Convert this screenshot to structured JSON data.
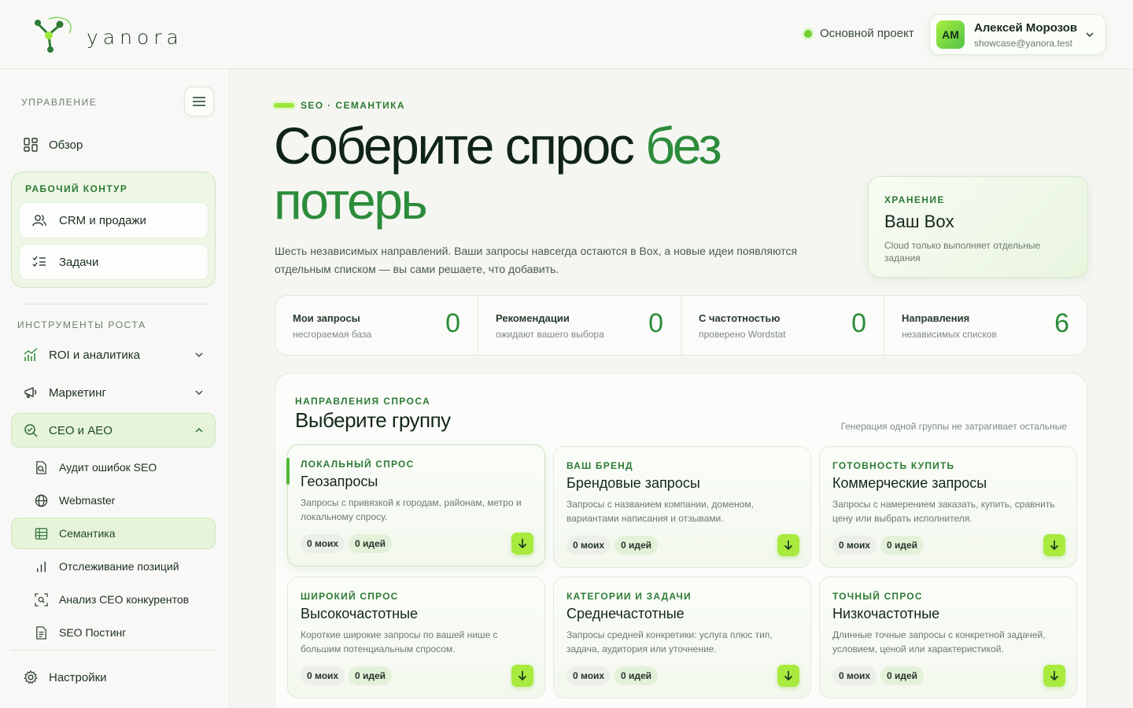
{
  "header": {
    "logo_text": "yanora",
    "project_label": "Основной проект",
    "user": {
      "initials": "AM",
      "name": "Алексей Морозов",
      "email": "showcase@yanora.test"
    }
  },
  "sidebar": {
    "section_manage": "УПРАВЛЕНИЕ",
    "overview": "Обзор",
    "work_title": "РАБОЧИЙ КОНТУР",
    "work_items": [
      "CRM и продажи",
      "Задачи"
    ],
    "section_growth": "ИНСТРУМЕНТЫ РОСТА",
    "roi": "ROI и аналитика",
    "marketing": "Маркетинг",
    "seo": "СЕО и АЕО",
    "seo_sub": [
      "Аудит ошибок SEO",
      "Webmaster",
      "Семантика",
      "Отслеживание позиций",
      "Анализ СЕО конкурентов",
      "SEO Постинг"
    ],
    "settings": "Настройки"
  },
  "main": {
    "eyebrow": "SEO · СЕМАНТИКА",
    "hero_part1": "Соберите спрос ",
    "hero_part2": "без потерь",
    "lead": "Шесть независимых направлений. Ваши запросы навсегда остаются в Box, а новые идеи появляются отдельным списком — вы сами решаете, что добавить.",
    "storage": {
      "label": "ХРАНЕНИЕ",
      "title": "Ваш Box",
      "desc": "Cloud только выполняет отдельные задания"
    },
    "stats": [
      {
        "title": "Мои запросы",
        "sub": "несгораемая база",
        "value": "0"
      },
      {
        "title": "Рекомендации",
        "sub": "ожидают вашего выбора",
        "value": "0"
      },
      {
        "title": "С частотностью",
        "sub": "проверено Wordstat",
        "value": "0"
      },
      {
        "title": "Направления",
        "sub": "независимых списков",
        "value": "6"
      }
    ],
    "panel": {
      "eyebrow": "НАПРАВЛЕНИЯ СПРОСА",
      "title": "Выберите группу",
      "note": "Генерация одной группы не затрагивает остальные"
    },
    "cards": [
      {
        "label": "ЛОКАЛЬНЫЙ СПРОС",
        "title": "Геозапросы",
        "desc": "Запросы с привязкой к городам, районам, метро и локальному спросу.",
        "mine": "0 моих",
        "ideas": "0 идей"
      },
      {
        "label": "ВАШ БРЕНД",
        "title": "Брендовые запросы",
        "desc": "Запросы с названием компании, доменом, вариантами написания и отзывами.",
        "mine": "0 моих",
        "ideas": "0 идей"
      },
      {
        "label": "ГОТОВНОСТЬ КУПИТЬ",
        "title": "Коммерческие запросы",
        "desc": "Запросы с намерением заказать, купить, сравнить цену или выбрать исполнителя.",
        "mine": "0 моих",
        "ideas": "0 идей"
      },
      {
        "label": "ШИРОКИЙ СПРОС",
        "title": "Высокочастотные",
        "desc": "Короткие широкие запросы по вашей нише с большим потенциальным спросом.",
        "mine": "0 моих",
        "ideas": "0 идей"
      },
      {
        "label": "КАТЕГОРИИ И ЗАДАЧИ",
        "title": "Среднечастотные",
        "desc": "Запросы средней конкретики: услуга плюс тип, задача, аудитория или уточнение.",
        "mine": "0 моих",
        "ideas": "0 идей"
      },
      {
        "label": "ТОЧНЫЙ СПРОС",
        "title": "Низкочастотные",
        "desc": "Длинные точные запросы с конкретной задачей, условием, ценой или характеристикой.",
        "mine": "0 моих",
        "ideas": "0 идей"
      }
    ]
  }
}
